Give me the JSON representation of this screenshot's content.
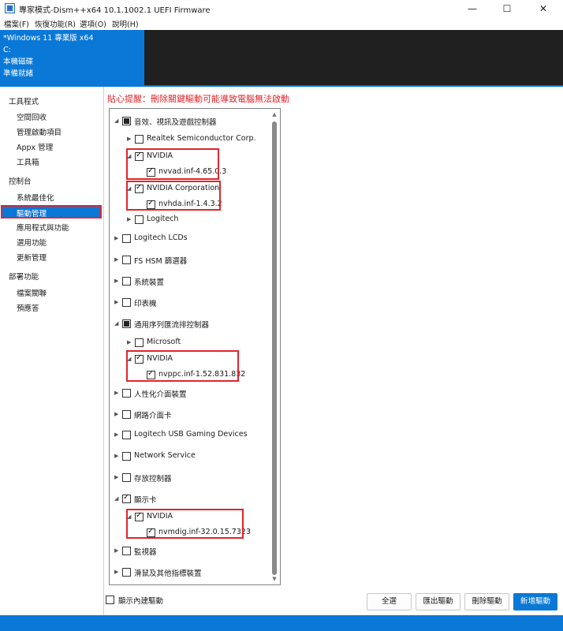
{
  "window": {
    "title": "專家模式-Dism++x64 10.1.1002.1 UEFI Firmware",
    "minimize": "—",
    "maximize": "☐",
    "close": "✕"
  },
  "menu": [
    "檔案(F)",
    "恢復功能(R)",
    "選項(O)",
    "說明(H)"
  ],
  "header": {
    "os": "*Windows 11 專業版 x64",
    "drive": "C:",
    "disk": "本機磁碟",
    "status": "準備就緒"
  },
  "sidebar": {
    "groups": [
      {
        "label": "工具程式",
        "items": [
          "空間回收",
          "管理啟動項目",
          "Appx 管理",
          "工具箱"
        ]
      },
      {
        "label": "控制台",
        "items": [
          "系統最佳化",
          "驅動管理",
          "應用程式與功能",
          "選用功能",
          "更新管理"
        ]
      },
      {
        "label": "部署功能",
        "items": [
          "檔案關聯",
          "預應答"
        ]
      }
    ],
    "selected": "驅動管理"
  },
  "warning": "貼心提醒：刪除關鍵驅動可能導致電腦無法啟動",
  "tree": [
    {
      "label": "音效、視訊及遊戲控制器",
      "state": "partial",
      "arrow": "◢"
    },
    {
      "label": "Realtek Semiconductor Corp.",
      "state": "unchecked",
      "arrow": "▶"
    },
    {
      "label": "NVIDIA",
      "state": "checked",
      "arrow": "◢"
    },
    {
      "label": "nvvad.inf-4.65.0.3",
      "state": "checked",
      "arrow": ""
    },
    {
      "label": "NVIDIA Corporation",
      "state": "checked",
      "arrow": "◢"
    },
    {
      "label": "nvhda.inf-1.4.3.2",
      "state": "checked",
      "arrow": ""
    },
    {
      "label": "Logitech",
      "state": "unchecked",
      "arrow": "▶"
    },
    {
      "label": "Logitech LCDs",
      "state": "unchecked",
      "arrow": "▶"
    },
    {
      "label": "FS HSM 篩選器",
      "state": "unchecked",
      "arrow": "▶"
    },
    {
      "label": "系統裝置",
      "state": "unchecked",
      "arrow": "▶"
    },
    {
      "label": "印表機",
      "state": "unchecked",
      "arrow": "▶"
    },
    {
      "label": "通用序列匯流排控制器",
      "state": "partial",
      "arrow": "◢"
    },
    {
      "label": "Microsoft",
      "state": "unchecked",
      "arrow": "▶"
    },
    {
      "label": "NVIDIA",
      "state": "checked",
      "arrow": "◢"
    },
    {
      "label": "nvppc.inf-1.52.831.832",
      "state": "checked",
      "arrow": ""
    },
    {
      "label": "人性化介面裝置",
      "state": "unchecked",
      "arrow": "▶"
    },
    {
      "label": "網路介面卡",
      "state": "unchecked",
      "arrow": "▶"
    },
    {
      "label": "Logitech USB Gaming Devices",
      "state": "unchecked",
      "arrow": "▶"
    },
    {
      "label": "Network Service",
      "state": "unchecked",
      "arrow": "▶"
    },
    {
      "label": "存放控制器",
      "state": "unchecked",
      "arrow": "▶"
    },
    {
      "label": "顯示卡",
      "state": "checked",
      "arrow": "◢"
    },
    {
      "label": "NVIDIA",
      "state": "checked",
      "arrow": "◢"
    },
    {
      "label": "nvmdig.inf-32.0.15.7323",
      "state": "checked",
      "arrow": ""
    },
    {
      "label": "監視器",
      "state": "unchecked",
      "arrow": "▶"
    },
    {
      "label": "滑鼠及其他指標裝置",
      "state": "unchecked",
      "arrow": "▶"
    }
  ],
  "scrollbar": {
    "up": "▲",
    "down": "▼"
  },
  "bottom": {
    "show_builtin": "顯示內建驅動",
    "select_all": "全選",
    "export": "匯出驅動",
    "delete": "刪除驅動",
    "add": "新增驅動"
  }
}
